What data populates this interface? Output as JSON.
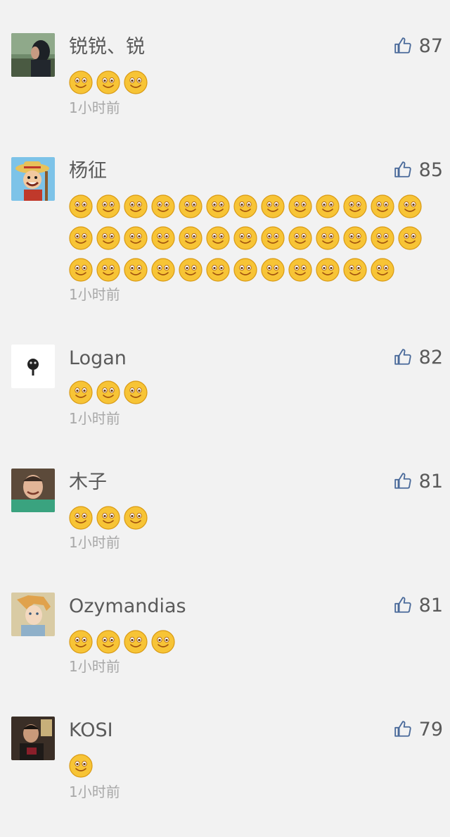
{
  "comments": [
    {
      "user": "锐锐、锐",
      "likes": "87",
      "emoji_count": 3,
      "time": "1小时前",
      "avatar_icon": "avatar-man-side-photo-icon"
    },
    {
      "user": "杨征",
      "likes": "85",
      "emoji_count": 38,
      "time": "1小时前",
      "avatar_icon": "avatar-cartoon-pirate-icon"
    },
    {
      "user": "Logan",
      "likes": "82",
      "emoji_count": 3,
      "time": "1小时前",
      "avatar_icon": "avatar-black-symbol-icon"
    },
    {
      "user": "木子",
      "likes": "81",
      "emoji_count": 3,
      "time": "1小时前",
      "avatar_icon": "avatar-smiling-man-photo-icon"
    },
    {
      "user": "Ozymandias",
      "likes": "81",
      "emoji_count": 4,
      "time": "1小时前",
      "avatar_icon": "avatar-anime-character-icon"
    },
    {
      "user": "KOSI",
      "likes": "79",
      "emoji_count": 1,
      "time": "1小时前",
      "avatar_icon": "avatar-person-dark-room-icon"
    }
  ],
  "emoji_icon": "smile-emoji-icon",
  "like_icon": "thumbs-up-icon",
  "colors": {
    "background": "#f2f2f2",
    "text": "#5a5a5a",
    "muted": "#a8a8a8",
    "like_icon": "#4a6a9a"
  }
}
